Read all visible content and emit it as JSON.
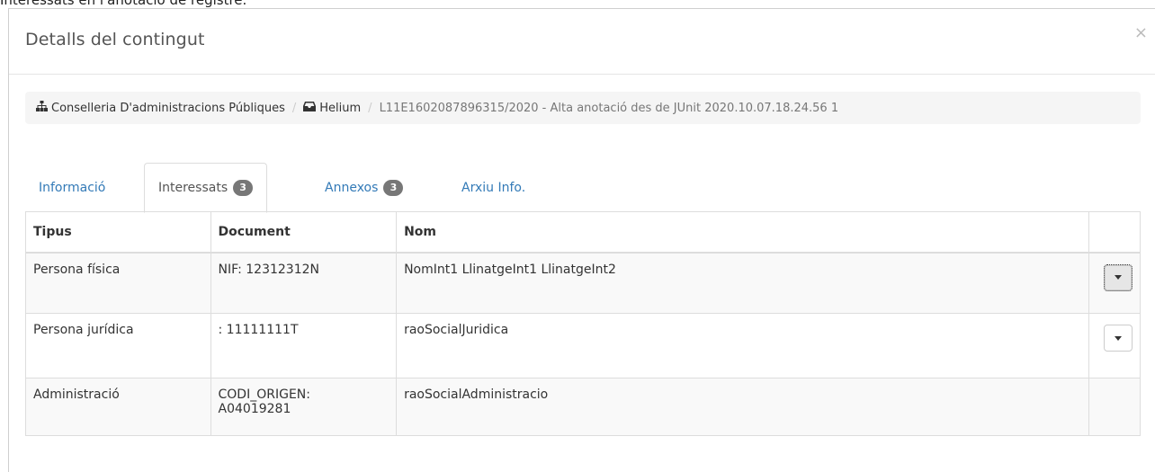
{
  "caption": "Interessats en l'anotació de registre.",
  "modal": {
    "title": "Detalls del contingut",
    "close": "×"
  },
  "breadcrumb": {
    "items": [
      {
        "icon": "sitemap-icon",
        "label": "Conselleria D'administracions Públiques"
      },
      {
        "icon": "inbox-icon",
        "label": "Helium"
      },
      {
        "label": "L11E1602087896315/2020 - Alta anotació des de JUnit 2020.10.07.18.24.56 1"
      }
    ],
    "separator": "/"
  },
  "tabs": [
    {
      "label": "Informació",
      "active": false
    },
    {
      "label": "Interessats",
      "badge": "3",
      "active": true
    },
    {
      "label": "Annexos",
      "badge": "3",
      "active": false
    },
    {
      "label": "Arxiu Info.",
      "active": false
    }
  ],
  "table": {
    "headers": [
      "Tipus",
      "Document",
      "Nom",
      ""
    ],
    "rows": [
      {
        "tipus": "Persona física",
        "document": [
          "NIF: 12312312N"
        ],
        "nom": "NomInt1 LlinatgeInt1 LlinatgeInt2",
        "has_action": true
      },
      {
        "tipus": "Persona jurídica",
        "document": [
          ": 11111111T"
        ],
        "nom": "raoSocialJuridica",
        "has_action": true
      },
      {
        "tipus": "Administració",
        "document": [
          "CODI_ORIGEN:",
          "A04019281"
        ],
        "nom": "raoSocialAdministracio",
        "has_action": false
      }
    ]
  }
}
